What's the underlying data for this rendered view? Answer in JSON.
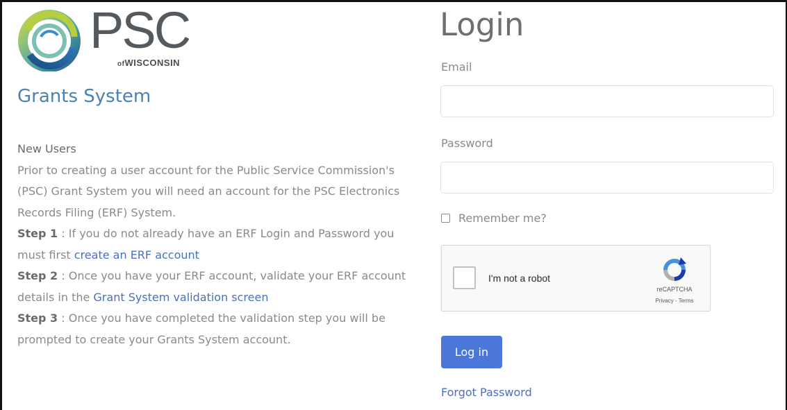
{
  "brand": {
    "logo_text": "PSC",
    "logo_sub_of": "of",
    "logo_sub_state": "WISCONSIN",
    "system_name": "Grants System"
  },
  "info": {
    "heading": "New Users",
    "intro": "Prior to creating a user account for the Public Service Commission's (PSC) Grant System you will need an account for the PSC Electronics Records Filing (ERF) System.",
    "steps": [
      {
        "label": "Step 1",
        "text_before": " : If you do not already have an ERF Login and Password you must first ",
        "link_text": "create an ERF account",
        "text_after": ""
      },
      {
        "label": "Step 2",
        "text_before": " : Once you have your ERF account, validate your ERF account details in the ",
        "link_text": "Grant System validation screen",
        "text_after": ""
      },
      {
        "label": "Step 3",
        "text_before": " : Once you have completed the validation step you will be prompted to create your Grants System account.",
        "link_text": "",
        "text_after": ""
      }
    ]
  },
  "login": {
    "title": "Login",
    "email_label": "Email",
    "email_value": "",
    "password_label": "Password",
    "password_value": "",
    "remember_label": "Remember me?",
    "remember_checked": false,
    "recaptcha": {
      "label": "I'm not a robot",
      "brand": "reCAPTCHA",
      "terms": "Privacy - Terms",
      "icon": "recaptcha-logo-icon"
    },
    "submit_label": "Log in",
    "forgot_label": "Forgot Password"
  },
  "colors": {
    "accent": "#4a77d9",
    "link": "#4a6fc3",
    "title_blue": "#4a82b6"
  }
}
